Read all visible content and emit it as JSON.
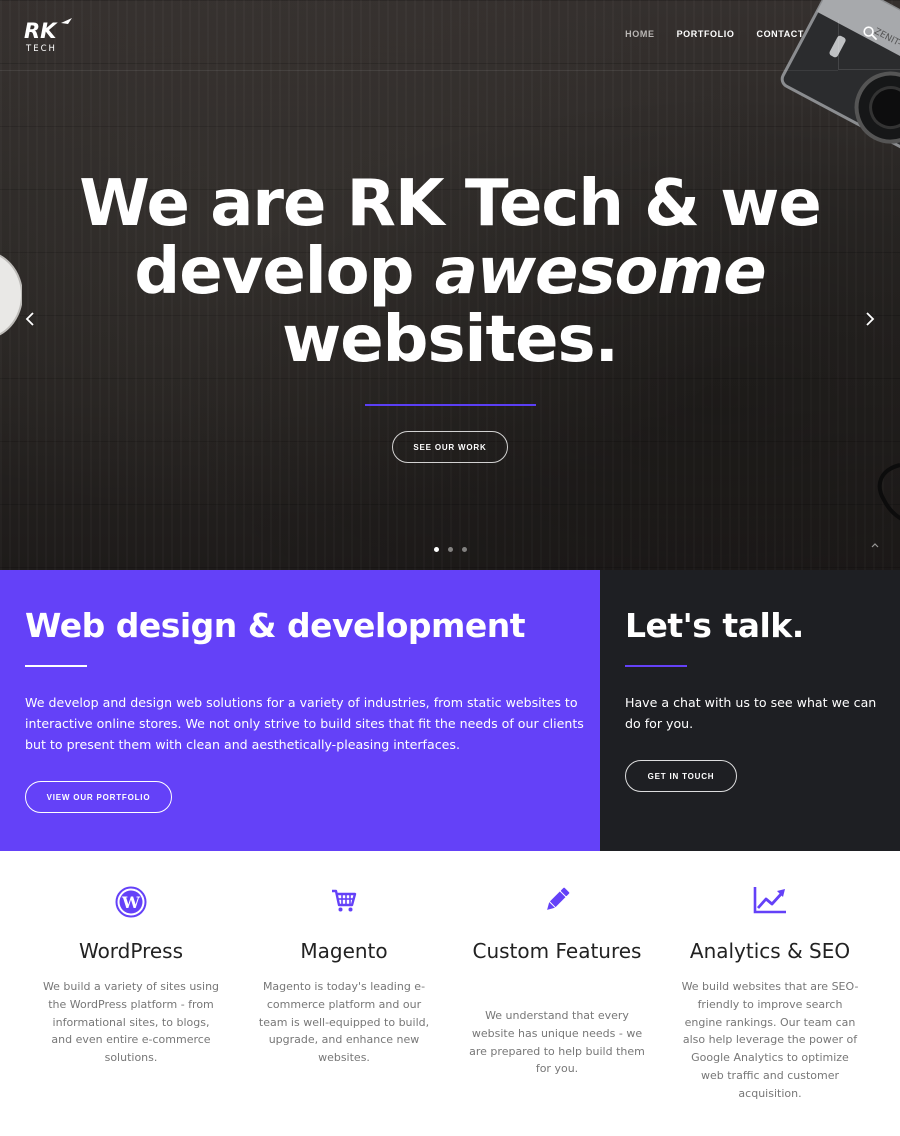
{
  "brand": {
    "logo_text": "RK",
    "logo_sub": "TECH",
    "accent": "#6441f8",
    "dark": "#1e1f23"
  },
  "nav": {
    "items": [
      "HOME",
      "PORTFOLIO",
      "CONTACT"
    ],
    "active": "HOME"
  },
  "hero": {
    "title_line1": "We are RK Tech & we",
    "title_line2_a": "develop ",
    "title_line2_b": "awesome",
    "title_line3": "websites.",
    "cta": "SEE OUR WORK",
    "slides": 3,
    "active_slide": 1
  },
  "design": {
    "heading": "Web design & development",
    "body": "We develop and design web solutions for a variety of industries, from static websites to interactive online stores. We not only strive to build sites that fit the needs of our clients but to present them with clean and aesthetically-pleasing interfaces.",
    "cta": "VIEW OUR PORTFOLIO"
  },
  "talk": {
    "heading": "Let's talk.",
    "body": "Have a chat with us to see what we can do for you.",
    "cta": "GET IN TOUCH"
  },
  "services": [
    {
      "icon": "wordpress-icon",
      "title": "WordPress",
      "body": "We build a variety of sites using the WordPress platform - from informational sites, to blogs, and even entire e-commerce solutions."
    },
    {
      "icon": "shopping-cart-icon",
      "title": "Magento",
      "body": "Magento is today's leading e-commerce platform and our team is well-equipped to build, upgrade, and enhance new websites."
    },
    {
      "icon": "pencil-icon",
      "title": "Custom Features",
      "body": "We understand that every website has unique needs - we are prepared to help build them for you."
    },
    {
      "icon": "line-chart-icon",
      "title": "Analytics & SEO",
      "body": "We build websites that are SEO-friendly to improve search engine rankings. Our team can also help leverage the power of Google Analytics to optimize web traffic and customer acquisition."
    }
  ]
}
